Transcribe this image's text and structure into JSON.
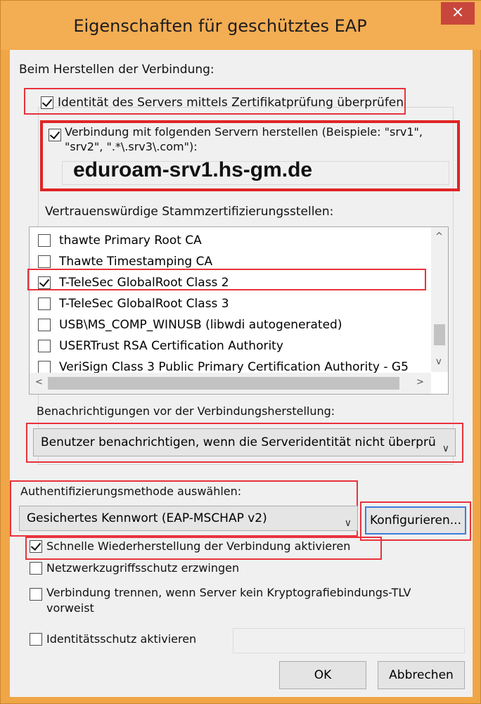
{
  "window": {
    "title": "Eigenschaften für geschütztes EAP",
    "close_glyph": "×"
  },
  "connect_section_label": "Beim Herstellen der Verbindung:",
  "verify_identity": {
    "checked": true,
    "label": "Identität des Servers mittels Zertifikatprüfung überprüfen"
  },
  "connect_servers": {
    "checked": true,
    "label_line1": "Verbindung mit folgenden Servern herstellen (Beispiele: \"srv1\",",
    "label_line2": "\"srv2\", \".*\\.srv3\\.com\"):",
    "value": "eduroam-srv1.hs-gm.de"
  },
  "trusted_roots": {
    "label": "Vertrauenswürdige Stammzertifizierungsstellen:",
    "items": [
      {
        "label": "thawte Primary Root CA",
        "checked": false
      },
      {
        "label": "Thawte Timestamping CA",
        "checked": false
      },
      {
        "label": "T-TeleSec GlobalRoot Class 2",
        "checked": true
      },
      {
        "label": "T-TeleSec GlobalRoot Class 3",
        "checked": false
      },
      {
        "label": "USB\\MS_COMP_WINUSB (libwdi autogenerated)",
        "checked": false
      },
      {
        "label": "USERTrust RSA Certification Authority",
        "checked": false
      },
      {
        "label": "VeriSign Class 3 Public Primary Certification Authority - G5",
        "checked": false
      }
    ],
    "scroll_up": "^",
    "scroll_down": "v",
    "scroll_left": "<",
    "scroll_right": ">"
  },
  "notifications": {
    "label": "Benachrichtigungen vor der Verbindungsherstellung:",
    "selected": "Benutzer benachrichtigen, wenn die Serveridentität nicht überprü"
  },
  "auth_method": {
    "label": "Authentifizierungsmethode auswählen:",
    "selected": "Gesichertes Kennwort (EAP-MSCHAP v2)",
    "configure_button": "Konfigurieren..."
  },
  "options": {
    "fast_reconnect": {
      "checked": true,
      "label": "Schnelle Wiederherstellung der Verbindung aktivieren"
    },
    "nap": {
      "checked": false,
      "label": "Netzwerkzugriffsschutz erzwingen"
    },
    "disconnect_tlv": {
      "checked": false,
      "label_line1": "Verbindung trennen, wenn Server kein Kryptografiebindungs-TLV",
      "label_line2": "vorweist"
    },
    "identity_privacy": {
      "checked": false,
      "label": "Identitätsschutz aktivieren"
    }
  },
  "buttons": {
    "ok": "OK",
    "cancel": "Abbrechen"
  },
  "chevron_glyph": "∨",
  "colors": {
    "frame": "#f0a646",
    "close": "#c8463c",
    "highlight": "#e8333c",
    "focus": "#3b7edb"
  }
}
